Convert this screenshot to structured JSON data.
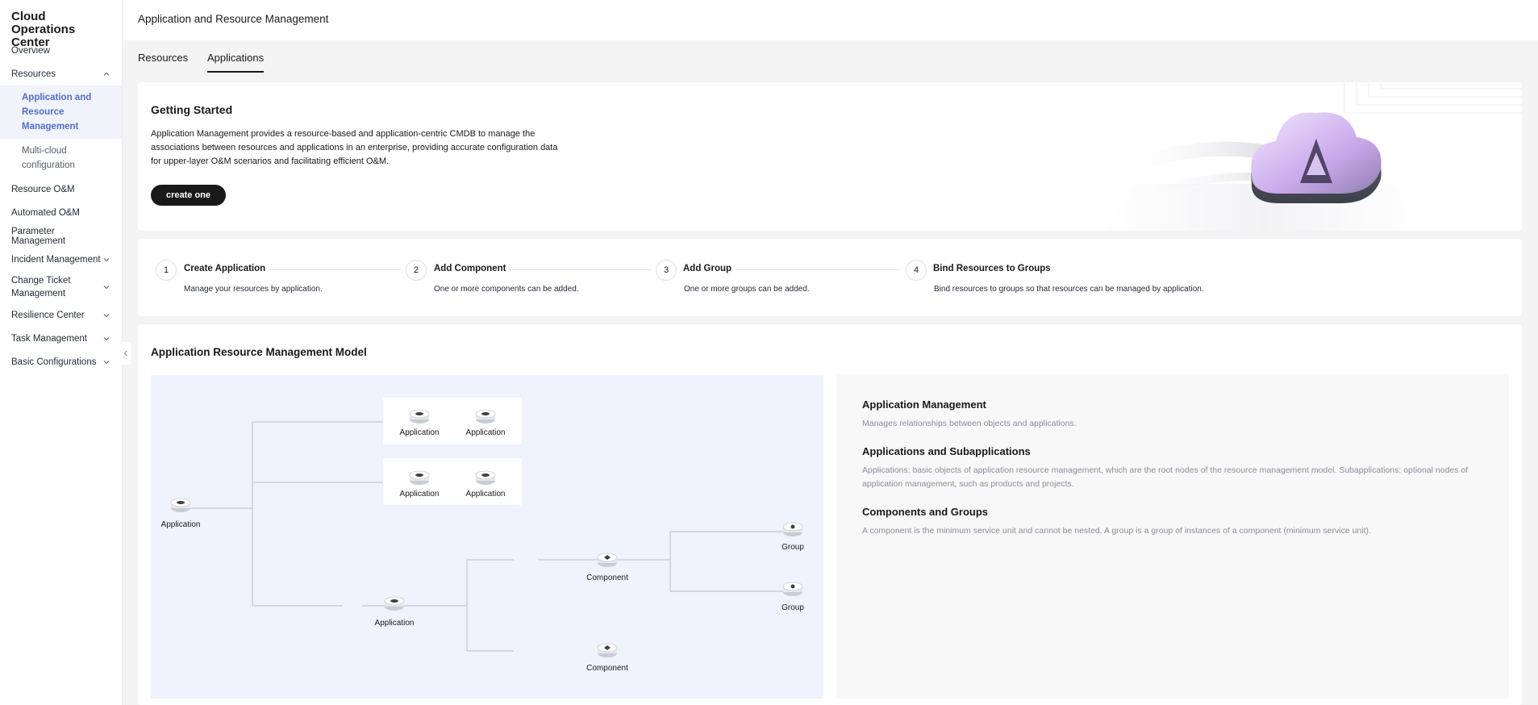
{
  "sidebar": {
    "brand": "Cloud Operations Center",
    "items": [
      {
        "label": "Overview"
      },
      {
        "label": "Resources"
      },
      {
        "label": "Application and Resource Management"
      },
      {
        "label": "Multi-cloud configuration"
      },
      {
        "label": "Resource O&M"
      },
      {
        "label": "Automated O&M"
      },
      {
        "label": "Parameter Management"
      },
      {
        "label": "Incident Management"
      },
      {
        "label": "Change Ticket Management"
      },
      {
        "label": "Resilience Center"
      },
      {
        "label": "Task Management"
      },
      {
        "label": "Basic Configurations"
      }
    ]
  },
  "header": {
    "title": "Application and Resource Management"
  },
  "tabs": [
    {
      "label": "Resources"
    },
    {
      "label": "Applications"
    }
  ],
  "getting_started": {
    "title": "Getting Started",
    "description": "Application Management provides a resource-based and application-centric CMDB to manage the associations between resources and applications in an enterprise, providing accurate configuration data for upper-layer O&M scenarios and facilitating efficient O&M.",
    "button_label": "create one"
  },
  "steps": [
    {
      "num": "1",
      "title": "Create Application",
      "desc": "Manage your resources by application."
    },
    {
      "num": "2",
      "title": "Add Component",
      "desc": "One or more components can be added."
    },
    {
      "num": "3",
      "title": "Add Group",
      "desc": "One or more groups can be added."
    },
    {
      "num": "4",
      "title": "Bind Resources to Groups",
      "desc": "Bind resources to groups so that resources can be managed by application."
    }
  ],
  "model": {
    "title": "Application Resource Management Model",
    "nodes": {
      "root": "Application",
      "app_a1": "Application",
      "app_a2": "Application",
      "app_b1": "Application",
      "app_b2": "Application",
      "app_c": "Application",
      "comp_1": "Component",
      "comp_2": "Component",
      "group_1": "Group",
      "group_2": "Group"
    },
    "info": [
      {
        "heading": "Application Management",
        "text": "Manages relationships between objects and applications."
      },
      {
        "heading": "Applications and Subapplications",
        "text": "Applications: basic objects of application resource management, which are the root nodes of the resource management model. Subapplications: optional nodes of application management, such as products and projects."
      },
      {
        "heading": "Components and Groups",
        "text": "A component is the minimum service unit and cannot be nested. A group is a group of instances of a component (minimum service unit)."
      }
    ]
  },
  "colors": {
    "accent": "#526ecc",
    "primary_button": "#191919",
    "diagram_bg": "#eef3fe"
  }
}
